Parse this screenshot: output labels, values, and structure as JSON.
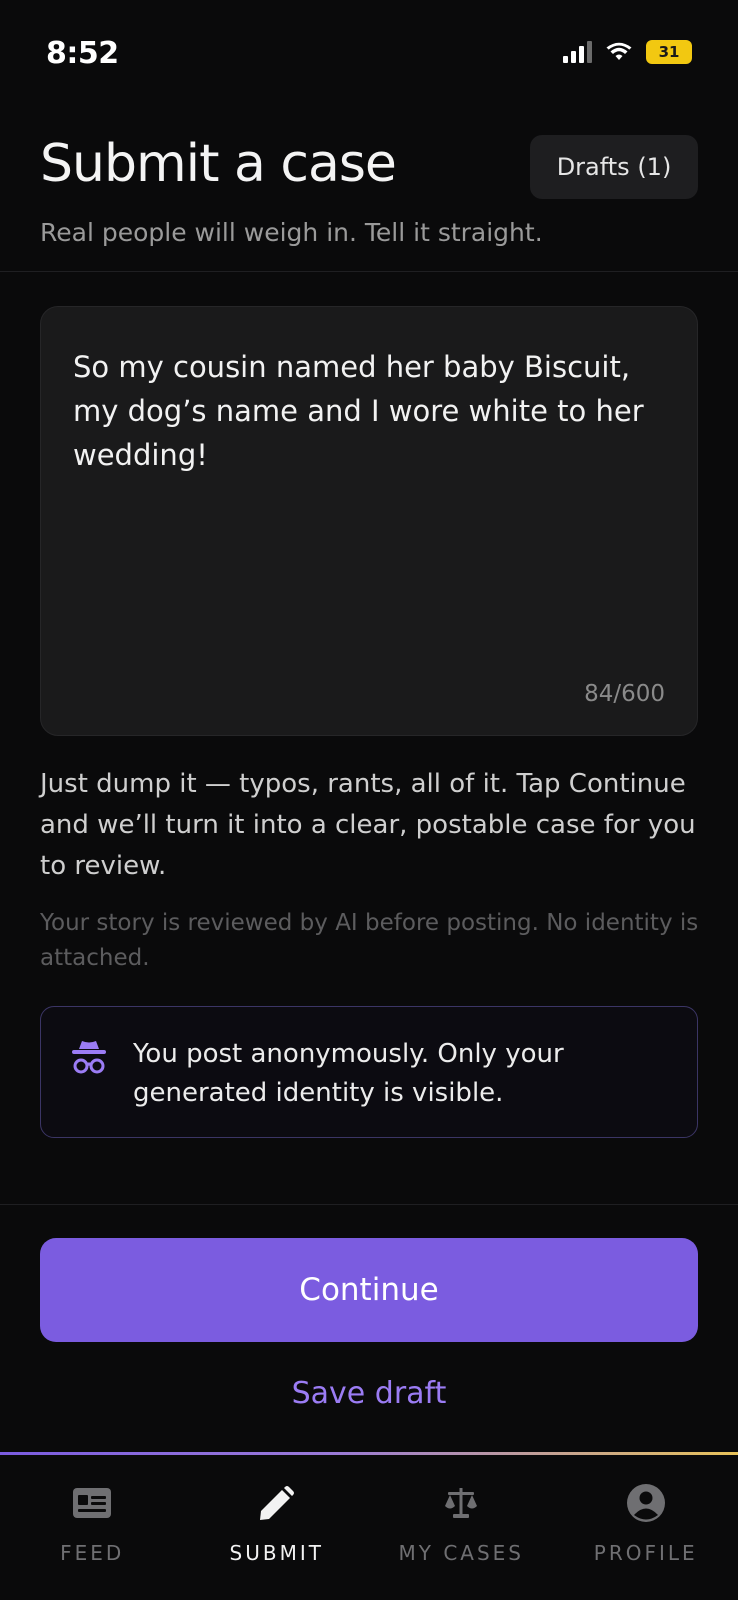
{
  "status_bar": {
    "time": "8:52",
    "battery": "31"
  },
  "header": {
    "title": "Submit a case",
    "drafts_label": "Drafts (1)",
    "subtitle": "Real people will weigh in. Tell it straight."
  },
  "editor": {
    "text": "So my cousin named her baby Biscuit, my dog’s name and I wore white to her wedding!",
    "char_count": "84/600"
  },
  "helper_text": "Just dump it — typos, rants, all of it. Tap Continue and we’ll turn it into a clear, postable case for you to review.",
  "review_notice": "Your story is reviewed by AI before posting. No identity is attached.",
  "anonymous_banner": {
    "icon": "incognito-icon",
    "text": "You post anonymously. Only your generated identity is visible."
  },
  "actions": {
    "continue_label": "Continue",
    "save_draft_label": "Save draft"
  },
  "bottom_nav": {
    "items": [
      {
        "label": "FEED",
        "icon": "feed-icon",
        "active": false
      },
      {
        "label": "SUBMIT",
        "icon": "pencil-icon",
        "active": true
      },
      {
        "label": "MY CASES",
        "icon": "scales-icon",
        "active": false
      },
      {
        "label": "PROFILE",
        "icon": "profile-icon",
        "active": false
      }
    ]
  },
  "colors": {
    "accent": "#7b5ce0",
    "accent_text": "#9b7cf4",
    "background": "#0a0a0b",
    "battery": "#f2c811"
  }
}
